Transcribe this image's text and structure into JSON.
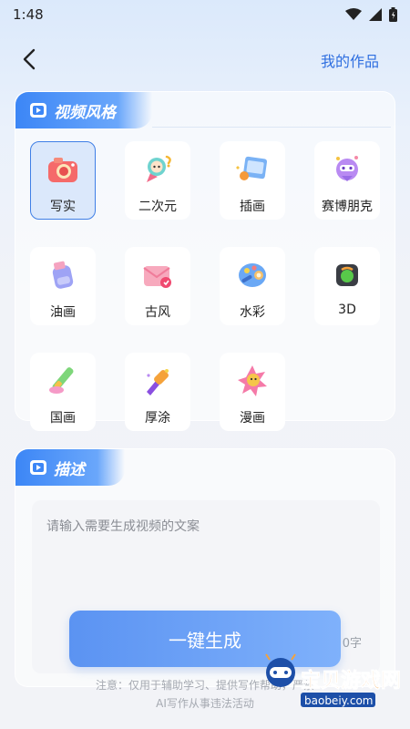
{
  "status_bar": {
    "time": "1:48"
  },
  "header": {
    "my_works_label": "我的作品"
  },
  "style_section": {
    "title": "视频风格",
    "selected": "写实",
    "items": [
      {
        "label": "写实",
        "icon": "camera-icon"
      },
      {
        "label": "二次元",
        "icon": "anime-character-icon"
      },
      {
        "label": "插画",
        "icon": "illustration-board-icon"
      },
      {
        "label": "赛博朋克",
        "icon": "cyberpunk-robot-icon"
      },
      {
        "label": "油画",
        "icon": "paint-bottle-icon"
      },
      {
        "label": "古风",
        "icon": "envelope-icon"
      },
      {
        "label": "水彩",
        "icon": "watercolor-palette-icon"
      },
      {
        "label": "3D",
        "icon": "3d-box-icon"
      },
      {
        "label": "国画",
        "icon": "brush-pen-icon"
      },
      {
        "label": "厚涂",
        "icon": "paint-brush-icon"
      },
      {
        "label": "漫画",
        "icon": "comic-burst-icon"
      }
    ]
  },
  "description_section": {
    "title": "描述",
    "placeholder": "请输入需要生成视频的文案",
    "char_count_suffix": "0字"
  },
  "generate_button_label": "一键生成",
  "notice_line1": "注意：仅用于辅助学习、提供写作帮助，严禁",
  "notice_line2": "AI写作从事违法活动",
  "watermark": {
    "text": "宝贝游戏网",
    "url_text": "baobeiy.com"
  },
  "colors": {
    "accent": "#2f6fe0",
    "tag_blue": "#3c86f6",
    "selected_bg": "#dbe8fb"
  }
}
